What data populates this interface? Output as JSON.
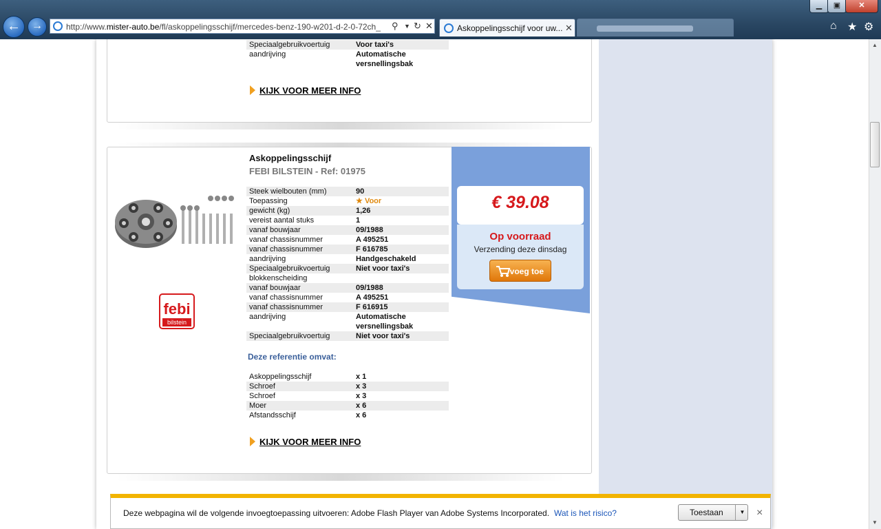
{
  "browser": {
    "url_prefix": "http://www.",
    "url_domain": "mister-auto.be",
    "url_path": "/fl/askoppelingsschijf/mercedes-benz-190-w201-d-2-0-72ch_",
    "tab1_title": "Askoppelingsschijf voor uw...",
    "window_controls": {
      "minimize": "▁",
      "maximize": "▣",
      "close": "✕"
    }
  },
  "card1": {
    "specs": [
      {
        "label": "Speciaalgebruikvoertuig",
        "value": "Voor taxi's"
      },
      {
        "label": "aandrijving",
        "value": "Automatische versnellingsbak"
      }
    ],
    "more_info": "KIJK VOOR MEER INFO"
  },
  "product": {
    "title": "Askoppelingsschijf",
    "brand_ref": "FEBI BILSTEIN - Ref: 01975",
    "logo_top": "febi",
    "logo_bottom": "bilstein",
    "specs": [
      {
        "label": "Steek wielbouten (mm)",
        "value": "90"
      },
      {
        "label": "Toepassing",
        "value": "Voor"
      },
      {
        "label": "gewicht (kg)",
        "value": "1,26"
      },
      {
        "label": "vereist aantal stuks",
        "value": "1"
      },
      {
        "label": "vanaf bouwjaar",
        "value": "09/1988"
      },
      {
        "label": "vanaf chassisnummer",
        "value": "A 495251"
      },
      {
        "label": "vanaf chassisnummer",
        "value": "F 616785"
      },
      {
        "label": "aandrijving",
        "value": "Handgeschakeld"
      },
      {
        "label": "Speciaalgebruikvoertuig",
        "value": "Niet voor taxi's"
      },
      {
        "label": "blokkenscheiding",
        "value": ""
      },
      {
        "label": "vanaf bouwjaar",
        "value": "09/1988"
      },
      {
        "label": "vanaf chassisnummer",
        "value": "A 495251"
      },
      {
        "label": "vanaf chassisnummer",
        "value": "F 616915"
      },
      {
        "label": "aandrijving",
        "value": "Automatische versnellingsbak"
      },
      {
        "label": "Speciaalgebruikvoertuig",
        "value": "Niet voor taxi's"
      }
    ],
    "includes_title": "Deze referentie omvat:",
    "includes": [
      {
        "label": "Askoppelingsschijf",
        "value": "x 1"
      },
      {
        "label": "Schroef",
        "value": "x 3"
      },
      {
        "label": "Schroef",
        "value": "x 3"
      },
      {
        "label": "Moer",
        "value": "x 6"
      },
      {
        "label": "Afstandsschijf",
        "value": "x 6"
      }
    ],
    "more_info": "KIJK VOOR MEER INFO",
    "price": "€ 39.08",
    "stock": "Op voorraad",
    "shipping": "Verzending deze dinsdag",
    "add_button": "voeg toe"
  },
  "notification": {
    "message": "Deze webpagina wil de volgende invoegtoepassing uitvoeren: Adobe Flash Player van Adobe Systems Incorporated.",
    "risk_link": "Wat is het risico?",
    "allow_button": "Toestaan",
    "close": "×"
  },
  "colors": {
    "accent_red": "#d6191c",
    "price_panel_blue": "#7aa0db",
    "button_orange": "#e0770a",
    "notification_yellow": "#f2b400"
  }
}
